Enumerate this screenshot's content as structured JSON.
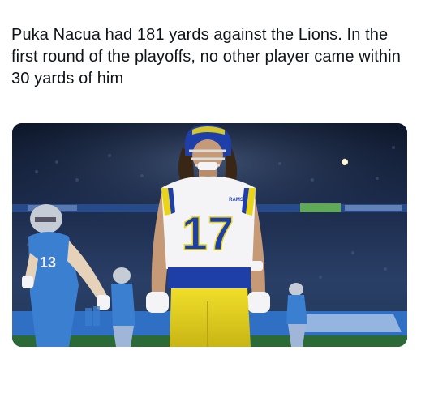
{
  "post": {
    "text": "Puka Nacua had 181 yards against the Lions. In the first round of the playoffs, no other player came within 30 yards of him"
  },
  "media": {
    "jersey_number": "17",
    "helmet_logo_text": "RAMS",
    "opponent_jersey_number": "13"
  },
  "colors": {
    "rams_blue": "#1f3fa8",
    "rams_yellow": "#e9d417",
    "lions_blue": "#3b7fd1",
    "jersey_white": "#f4f4f6",
    "text": "#0f1419"
  }
}
